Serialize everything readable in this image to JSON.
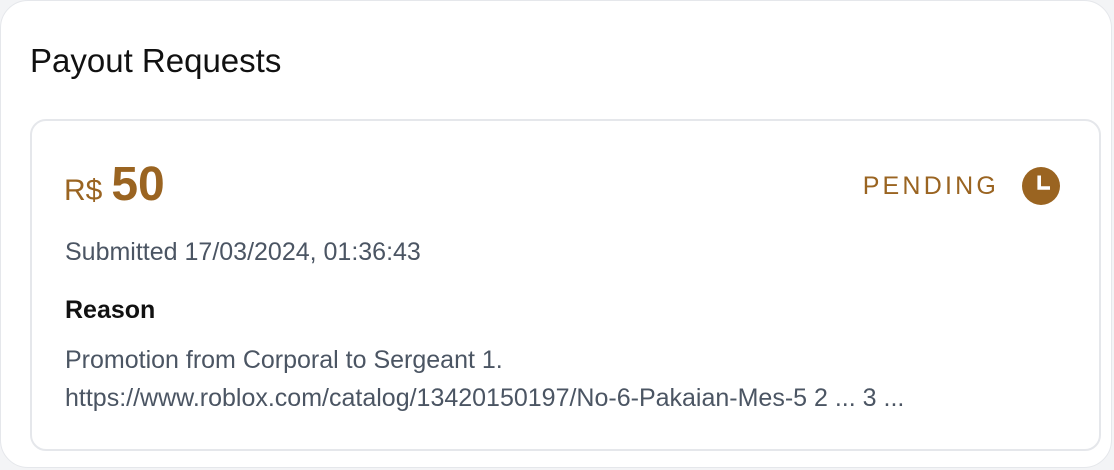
{
  "page": {
    "title": "Payout Requests"
  },
  "request": {
    "currency": "R$",
    "amount": "50",
    "status": "PENDING",
    "status_icon": "clock-icon",
    "submitted": "Submitted 17/03/2024, 01:36:43",
    "reason_label": "Reason",
    "reason_lines": [
      "Promotion from Corporal to Sergeant 1.",
      "https://www.roblox.com/catalog/13420150197/No-6-Pakaian-Mes-5 2 ... 3 ..."
    ]
  },
  "colors": {
    "accent": "#9A6421",
    "muted_text": "#4B5563",
    "border": "#E5E7EB"
  }
}
